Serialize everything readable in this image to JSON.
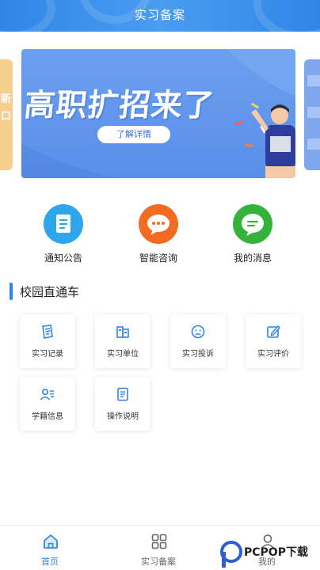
{
  "header": {
    "title": "实习备案"
  },
  "banner": {
    "headline": "高职扩招来了",
    "button_label": "了解详情",
    "peek_left_text": "新\n口"
  },
  "quick_actions": [
    {
      "label": "通知公告",
      "icon": "notice-icon",
      "color": "#2ea6ee"
    },
    {
      "label": "智能咨询",
      "icon": "chat-icon",
      "color": "#f26b21"
    },
    {
      "label": "我的消息",
      "icon": "message-icon",
      "color": "#33b33a"
    }
  ],
  "section": {
    "title": "校园直通车"
  },
  "grid_items": [
    {
      "label": "实习记录",
      "icon": "record-icon"
    },
    {
      "label": "实习单位",
      "icon": "building-icon"
    },
    {
      "label": "实习投诉",
      "icon": "complaint-icon"
    },
    {
      "label": "实习评价",
      "icon": "edit-icon"
    },
    {
      "label": "学籍信息",
      "icon": "student-info-icon"
    },
    {
      "label": "操作说明",
      "icon": "document-icon"
    }
  ],
  "tabbar": {
    "items": [
      {
        "label": "首页",
        "icon": "home-icon",
        "active": true
      },
      {
        "label": "实习备案",
        "icon": "grid-icon",
        "active": false
      },
      {
        "label": "我的",
        "icon": "user-icon",
        "active": false
      }
    ]
  },
  "watermark": {
    "text": "PCPOP下载"
  },
  "colors": {
    "primary": "#2f86e6",
    "accent_orange": "#f26b21",
    "accent_green": "#33b33a"
  }
}
